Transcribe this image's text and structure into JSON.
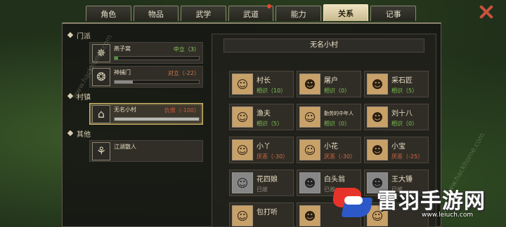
{
  "tabs": [
    {
      "label": "角色",
      "active": false,
      "badge": false
    },
    {
      "label": "物品",
      "active": false,
      "badge": false
    },
    {
      "label": "武学",
      "active": false,
      "badge": false
    },
    {
      "label": "武道",
      "active": false,
      "badge": true
    },
    {
      "label": "能力",
      "active": false,
      "badge": false
    },
    {
      "label": "关系",
      "active": true,
      "badge": false
    },
    {
      "label": "记事",
      "active": false,
      "badge": false
    }
  ],
  "sections": [
    {
      "label": "门派",
      "entries": [
        {
          "name": "燕子窝",
          "relation": "中立（3）",
          "relation_color": "#8fcf5a",
          "fill": 0.03,
          "fill_color": "#49a034",
          "emblem": "✵",
          "selected": false
        },
        {
          "name": "神捕门",
          "relation": "对立（-22）",
          "relation_color": "#d47a4a",
          "fill": 0.22,
          "fill_color": "#8a8a8a",
          "emblem": "❂",
          "selected": false
        }
      ]
    },
    {
      "label": "村镇",
      "entries": [
        {
          "name": "无名小村",
          "relation": "仇恨（-100）",
          "relation_color": "#d45a3a",
          "fill": 1.0,
          "fill_color": "#b8b8b4",
          "emblem": "⌂",
          "selected": true
        }
      ]
    },
    {
      "label": "其他",
      "entries": [
        {
          "name": "江湖散人",
          "relation": "",
          "relation_color": "#d7cdb3",
          "fill": null,
          "fill_color": "",
          "emblem": "⚘",
          "selected": false
        }
      ]
    }
  ],
  "village_title": "无名小村",
  "npcs": [
    {
      "name": "村长",
      "status": "相识（10）",
      "tone": "green",
      "grey": false,
      "face": "☺"
    },
    {
      "name": "屠户",
      "status": "相识（0）",
      "tone": "green",
      "grey": false,
      "face": "☻"
    },
    {
      "name": "采石匠",
      "status": "相识（5）",
      "tone": "green",
      "grey": false,
      "face": "☻"
    },
    {
      "name": "渔夫",
      "status": "相识（5）",
      "tone": "green",
      "grey": false,
      "face": "☺"
    },
    {
      "name": "勤劳的中年人",
      "status": "相识（0）",
      "tone": "green",
      "grey": false,
      "face": "☺",
      "small": true
    },
    {
      "name": "刘十八",
      "status": "相识（0）",
      "tone": "green",
      "grey": false,
      "face": "☻"
    },
    {
      "name": "小丫",
      "status": "厌恶（-30）",
      "tone": "red",
      "grey": false,
      "face": "☺"
    },
    {
      "name": "小花",
      "status": "厌恶（-30）",
      "tone": "red",
      "grey": false,
      "face": "☺"
    },
    {
      "name": "小宝",
      "status": "厌恶（-25）",
      "tone": "red",
      "grey": false,
      "face": "☻"
    },
    {
      "name": "花四娘",
      "status": "已故",
      "tone": "grey",
      "grey": true,
      "face": "☺"
    },
    {
      "name": "白头翁",
      "status": "已故",
      "tone": "grey",
      "grey": true,
      "face": "☻"
    },
    {
      "name": "王大锤",
      "status": "已故",
      "tone": "grey",
      "grey": true,
      "face": "☻"
    },
    {
      "name": "包打听",
      "status": "",
      "tone": "grey",
      "grey": false,
      "face": "☺"
    },
    {
      "name": "",
      "status": "",
      "tone": "grey",
      "grey": false,
      "face": "☻"
    },
    {
      "name": "",
      "status": "",
      "tone": "grey",
      "grey": false,
      "face": "☺"
    }
  ],
  "watermarks": [
    "www.hackhome.com",
    "www.hackhome.com"
  ],
  "logo": {
    "brand": "雷羽手游网",
    "url": "www.leiuch.com",
    "colors": [
      "#e8332b",
      "#2d59c8"
    ]
  }
}
